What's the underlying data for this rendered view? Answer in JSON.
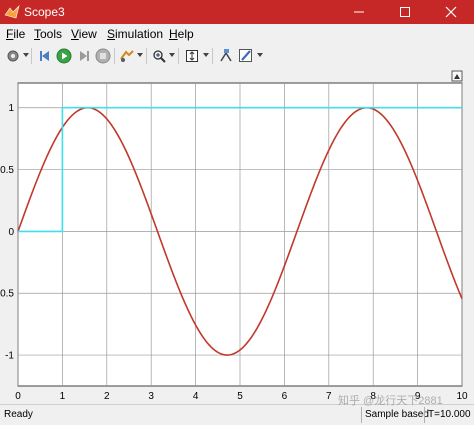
{
  "window": {
    "title": "Scope3",
    "accent": "#c62828",
    "minimize_icon": "minimize-icon",
    "maximize_icon": "maximize-icon",
    "close_icon": "close-icon"
  },
  "menu": [
    {
      "key": "F",
      "rest": "ile"
    },
    {
      "key": "T",
      "rest": "ools"
    },
    {
      "key": "V",
      "rest": "iew"
    },
    {
      "key": "S",
      "rest": "imulation"
    },
    {
      "key": "H",
      "rest": "elp"
    }
  ],
  "toolbar": {
    "icons": [
      "gear-icon",
      "step-back-icon",
      "run-icon",
      "step-forward-icon",
      "stop-icon",
      "highlight-icon",
      "zoom-icon",
      "autoscale-icon",
      "cursor-measure-icon",
      "style-icon"
    ]
  },
  "chart_data": {
    "type": "line",
    "title": "",
    "xlabel": "",
    "ylabel": "",
    "xlim": [
      0,
      10
    ],
    "ylim": [
      -1.25,
      1.2
    ],
    "xticks": [
      "0",
      "1",
      "2",
      "3",
      "4",
      "5",
      "6",
      "7",
      "8",
      "9",
      "10"
    ],
    "yticks": [
      "1",
      "0.5",
      "0",
      "-0.5",
      "-1"
    ],
    "grid": true,
    "background": "#ffffff",
    "series": [
      {
        "name": "",
        "color": "#c0392b",
        "kind": "sin",
        "x": [
          0,
          0.5,
          1,
          1.5,
          1.57,
          2,
          2.5,
          3,
          3.5,
          4,
          4.5,
          4.71,
          5,
          5.5,
          6,
          6.5,
          7,
          7.5,
          7.85,
          8,
          8.5,
          9,
          9.5,
          10
        ],
        "y": [
          0,
          0.479,
          0.841,
          0.997,
          1.0,
          0.909,
          0.598,
          0.141,
          -0.351,
          -0.757,
          -0.978,
          -1.0,
          -0.959,
          -0.706,
          -0.279,
          0.215,
          0.657,
          0.938,
          1.0,
          0.989,
          0.798,
          0.412,
          -0.075,
          -0.544
        ]
      },
      {
        "name": "",
        "color": "#40e0e8",
        "kind": "step",
        "x": [
          0,
          1,
          1,
          10
        ],
        "y": [
          0,
          0,
          1,
          1
        ]
      }
    ]
  },
  "status": {
    "left": "Ready",
    "mode": "Sample based",
    "time": "T=10.000"
  },
  "watermark": "知乎 @龙行天下2881"
}
